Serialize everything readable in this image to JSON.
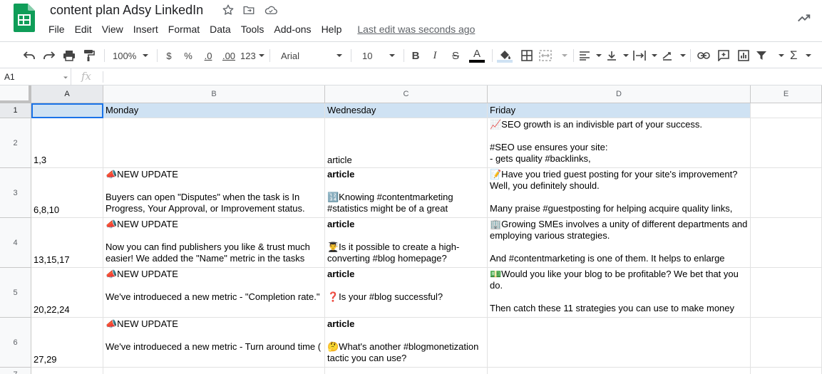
{
  "app": {
    "doc_title": "content plan Adsy LinkedIn",
    "menus": [
      "File",
      "Edit",
      "View",
      "Insert",
      "Format",
      "Data",
      "Tools",
      "Add-ons",
      "Help"
    ],
    "last_edit": "Last edit was seconds ago",
    "logo_color": "#0f9d58"
  },
  "toolbar": {
    "zoom": "100%",
    "currency": "$",
    "percent": "%",
    "dec_decrease": ".0",
    "dec_increase": ".00",
    "number_format": "123",
    "font": "Arial",
    "font_size": "10",
    "bold": "B",
    "italic": "I",
    "strike": "S",
    "text_color": "A",
    "text_color_value": "#000000",
    "fill_color_value": "#cfe2f3"
  },
  "formula_bar": {
    "name_box": "A1",
    "fx": "fx",
    "formula": ""
  },
  "grid": {
    "columns": [
      "A",
      "B",
      "C",
      "D",
      "E"
    ],
    "row_numbers": [
      "1",
      "2",
      "3",
      "4",
      "5",
      "6",
      "7"
    ],
    "header_row": [
      "",
      "Monday",
      "Wednesday",
      "Friday"
    ],
    "header_fill": "#cfe2f3",
    "selection_color": "#1a73e8",
    "rows": [
      {
        "a": "1,3",
        "b": "",
        "c": "article",
        "d": "📈SEO growth is an indivisble part of your success.\n\n#SEO use ensures your site:\n- gets quality #backlinks,"
      },
      {
        "a": "6,8,10",
        "b": "📣NEW UPDATE\n\nBuyers can open \"Disputes\" when the task is In Progress, Your Approval, or Improvement status.",
        "c_title": "article",
        "c": "🔢Knowing #contentmarketing #statistics might be of a great",
        "d": "📝Have you tried guest posting for your site's improvement? Well, you definitely should.\n\nMany praise #guestposting for helping acquire quality links,"
      },
      {
        "a": "13,15,17",
        "b": "📣NEW UPDATE\n\nNow you can find publishers you like & trust much easier! We added the \"Name\" metric in the tasks",
        "c_title": "article",
        "c": "👨‍🎓Is it possible to create a high-converting #blog homepage?",
        "d": "🏢Growing SMEs involves a unity of different departments and employing various strategies.\n\nAnd #contentmarketing is one of them. It helps to enlarge"
      },
      {
        "a": "20,22,24",
        "b": "📣NEW UPDATE\n\nWe've introdueced a new metric - \"Completion rate.\"",
        "c_title": "article",
        "c": "❓Is your #blog successful?",
        "d": "💵Would you like your blog to be profitable? We bet that you do.\n\nThen catch these 11 strategies you can use to make money"
      },
      {
        "a": "27,29",
        "b": "📣NEW UPDATE\n\nWe've introdueced a new metric - Turn around time (",
        "c_title": "article",
        "c": "🤔What's another #blogmonetization tactic you can use?",
        "d": ""
      }
    ]
  }
}
